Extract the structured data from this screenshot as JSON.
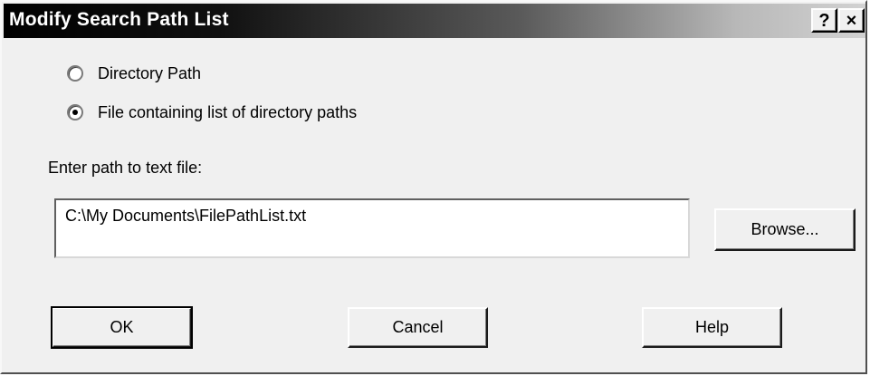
{
  "window": {
    "title": "Modify Search Path List",
    "help_glyph": "?",
    "close_glyph": "×"
  },
  "options": {
    "directory_path": {
      "label": "Directory Path",
      "checked": false
    },
    "file_list": {
      "label": "File containing list of directory paths",
      "checked": true
    }
  },
  "path_field": {
    "label": "Enter path to text file:",
    "value": "C:\\My Documents\\FilePathList.txt"
  },
  "buttons": {
    "browse": "Browse...",
    "ok": "OK",
    "cancel": "Cancel",
    "help": "Help"
  },
  "icons": {
    "help": "question-mark-icon",
    "close": "close-icon"
  }
}
